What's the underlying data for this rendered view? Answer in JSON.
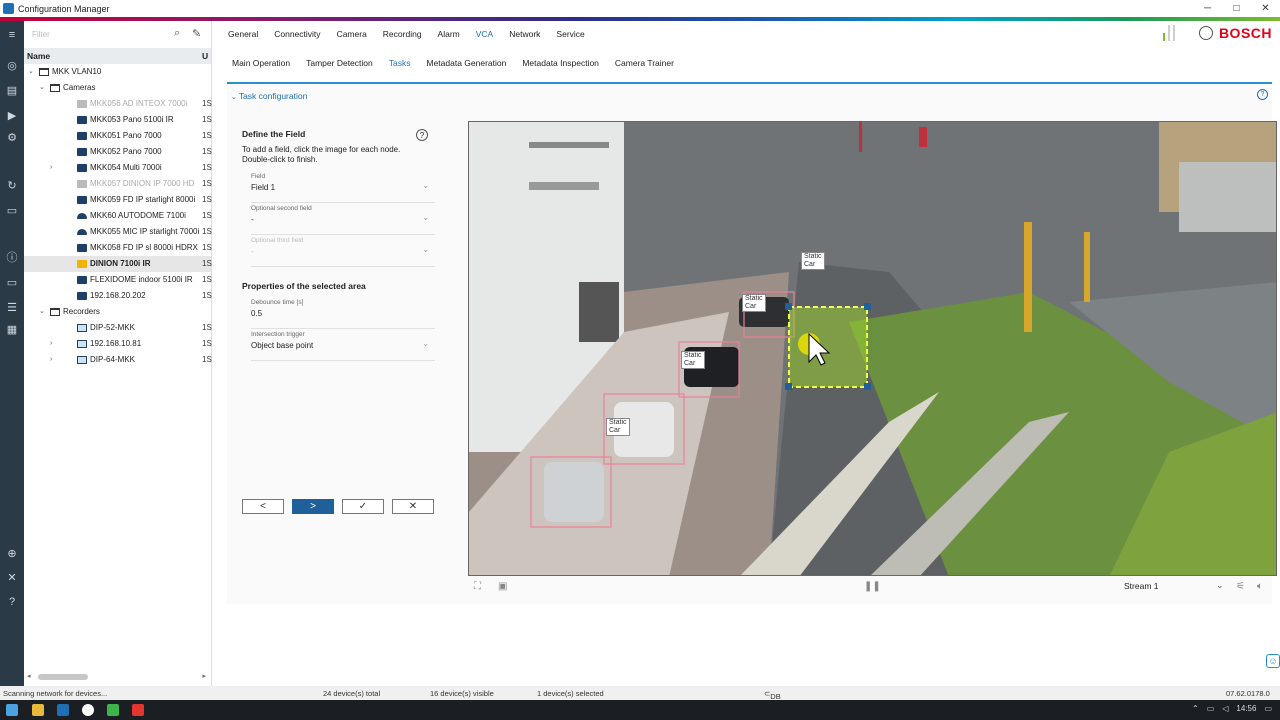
{
  "window": {
    "title": "Configuration Manager",
    "controls": [
      "─",
      "□",
      "✕"
    ]
  },
  "filter": {
    "placeholder": "Filter"
  },
  "tree": {
    "col_name": "Name",
    "col_u": "U",
    "rows": [
      {
        "label": "MKK VLAN10",
        "level": 0,
        "icon": "folder-icon",
        "expander": "⌄",
        "num": ""
      },
      {
        "label": "Cameras",
        "level": 1,
        "icon": "folder-icon",
        "expander": "⌄",
        "num": ""
      },
      {
        "label": "MKK056 AD INTEOX 7000i",
        "level": 2,
        "icon": "camera-icon",
        "dim": true,
        "num": "1S"
      },
      {
        "label": "MKK053 Pano 5100i IR",
        "level": 2,
        "icon": "camera-icon",
        "num": "1S"
      },
      {
        "label": "MKK051 Pano 7000",
        "level": 2,
        "icon": "camera-icon",
        "num": "1S"
      },
      {
        "label": "MKK052 Pano 7000",
        "level": 2,
        "icon": "camera-icon",
        "num": "1S"
      },
      {
        "label": "MKK054 Multi 7000i",
        "level": 2,
        "icon": "camera-icon",
        "expander": "›",
        "num": "1S"
      },
      {
        "label": "MKK057 DINION IP 7000 HD",
        "level": 2,
        "icon": "camera-icon",
        "dim": true,
        "num": "1S"
      },
      {
        "label": "MKK059 FD IP starlight 8000i",
        "level": 2,
        "icon": "camera-icon",
        "num": "1S"
      },
      {
        "label": "MKK60 AUTODOME 7100i",
        "level": 2,
        "icon": "dome-icon",
        "num": "1S"
      },
      {
        "label": "MKK055 MIC IP starlight 7000i",
        "level": 2,
        "icon": "dome-icon",
        "num": "1S"
      },
      {
        "label": "MKK058 FD IP sl 8000i HDRX",
        "level": 2,
        "icon": "camera-icon",
        "num": "1S"
      },
      {
        "label": "DINION 7100i IR",
        "level": 2,
        "icon": "camera-icon",
        "selected": true,
        "num": "1S"
      },
      {
        "label": "FLEXIDOME indoor 5100i IR",
        "level": 2,
        "icon": "camera-icon",
        "num": "1S"
      },
      {
        "label": "192.168.20.202",
        "level": 2,
        "icon": "camera-icon",
        "num": "1S"
      },
      {
        "label": "Recorders",
        "level": 1,
        "icon": "folder-icon",
        "expander": "⌄",
        "num": ""
      },
      {
        "label": "DIP-52-MKK",
        "level": 2,
        "icon": "recorder-icon",
        "num": "1S"
      },
      {
        "label": "192.168.10.81",
        "level": 2,
        "icon": "recorder-icon",
        "expander": "›",
        "num": "1S"
      },
      {
        "label": "DIP-64-MKK",
        "level": 2,
        "icon": "recorder-icon",
        "expander": "›",
        "num": "1S"
      }
    ]
  },
  "main_tabs": [
    "General",
    "Connectivity",
    "Camera",
    "Recording",
    "Alarm",
    "VCA",
    "Network",
    "Service"
  ],
  "main_tab_active": "VCA",
  "brand": {
    "name": "BOSCH",
    "accent": "#e2001a"
  },
  "sub_tabs": [
    "Main Operation",
    "Tamper Detection",
    "Tasks",
    "Metadata Generation",
    "Metadata Inspection",
    "Camera Trainer"
  ],
  "sub_tab_active": "Tasks",
  "panel": {
    "header": "Task configuration"
  },
  "form": {
    "define_heading": "Define the Field",
    "define_desc": "To add a field, click the image for each node. Double-click to finish.",
    "field_label": "Field",
    "field_value": "Field 1",
    "second_label": "Optional second field",
    "second_value": "-",
    "third_label": "Optional third field",
    "third_value": "-",
    "props_heading": "Properties of the selected area",
    "debounce_label": "Debounce time [s]",
    "debounce_value": "0.5",
    "trigger_label": "Intersection trigger",
    "trigger_value": "Object base point",
    "buttons": {
      "back": "<",
      "next": ">",
      "ok": "✓",
      "cancel": "✕"
    }
  },
  "video": {
    "labels": [
      {
        "line1": "Static",
        "line2": "Car"
      },
      {
        "line1": "Static",
        "line2": "Car"
      },
      {
        "line1": "Static",
        "line2": "Car"
      },
      {
        "line1": "Static",
        "line2": "Car"
      }
    ],
    "field_color": "#9acd32",
    "box_color": "#e8829a"
  },
  "stream": {
    "value": "Stream 1"
  },
  "status": {
    "left": "Scanning network for devices...",
    "total": "24 device(s) total",
    "visible": "16 device(s) visible",
    "selected": "1 device(s) selected",
    "db": "DB local",
    "version": "07.62.0178.0"
  },
  "taskbar": {
    "time": "14:56"
  }
}
